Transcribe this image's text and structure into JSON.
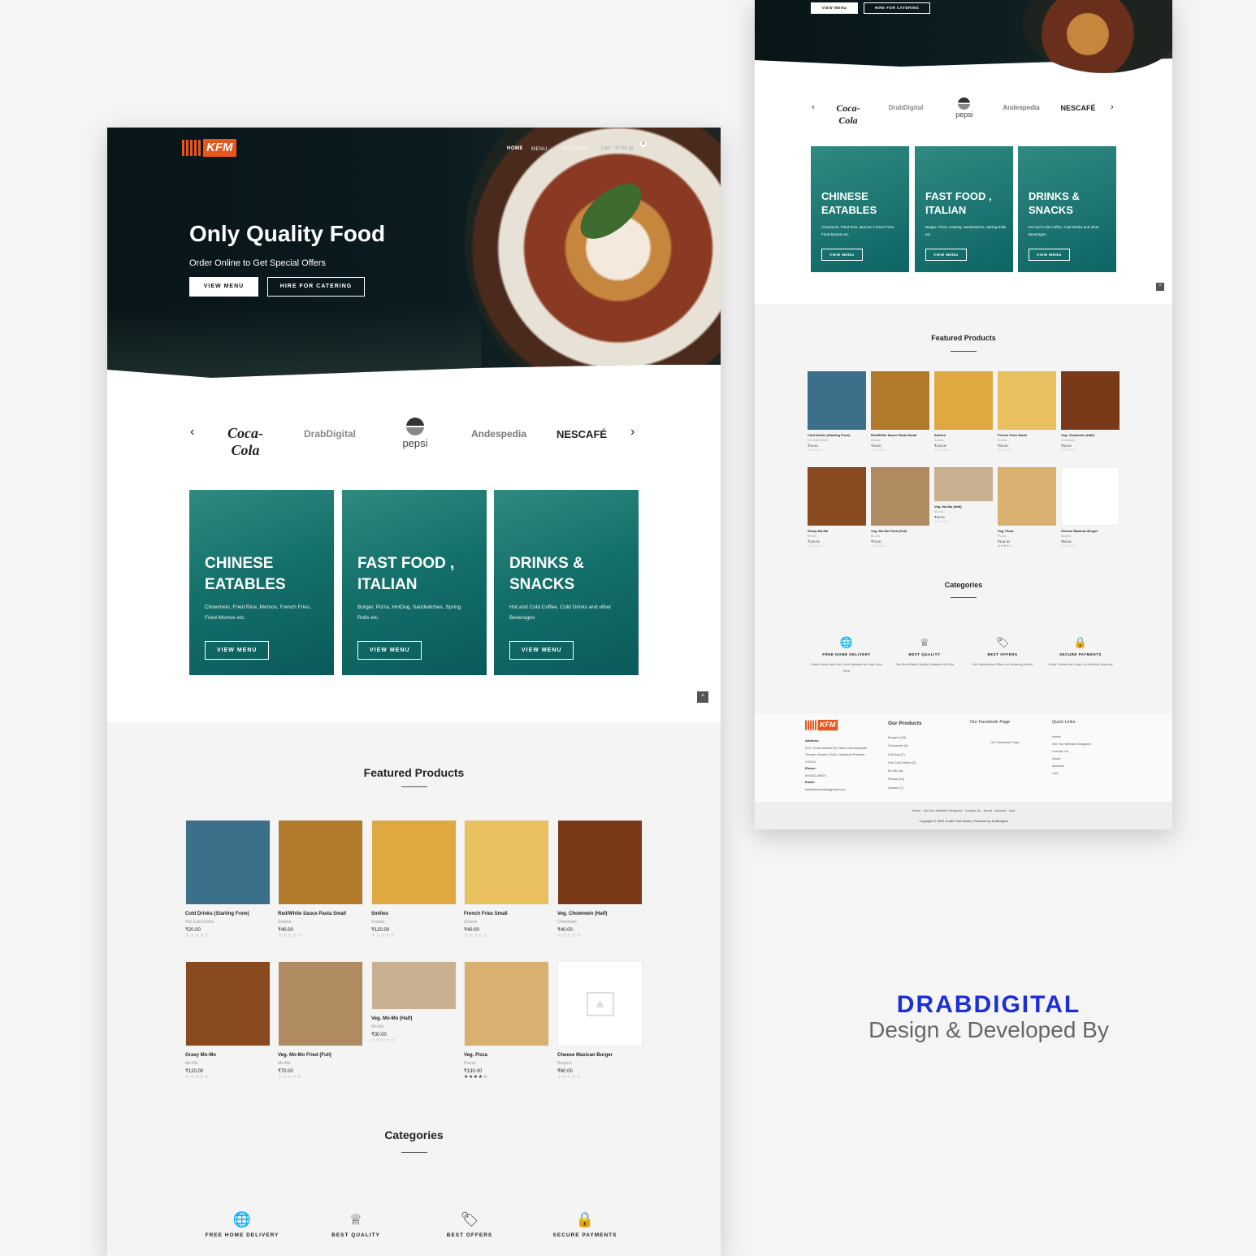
{
  "main": {
    "nav": {
      "logo_text": "KFM",
      "home": "HOME",
      "menu": "MENU",
      "account": "ACCOUNT",
      "cart": "Cart / ₹0.00",
      "cart_count": "0"
    },
    "hero": {
      "title": "Only Quality Food",
      "subtitle": "Order Online to Get Special Offers",
      "view_menu": "VIEW MENU",
      "hire": "HIRE FOR CATERING"
    },
    "brands": [
      "Coca-Cola",
      "DrabDigital",
      "pepsi",
      "Andespedia",
      "NESCAFÉ"
    ],
    "categories": [
      {
        "title": "CHINESE EATABLES",
        "desc": "Chowmein, Fried Rice, Momos, French Fries, Fried Momos etc.",
        "button": "VIEW MENU"
      },
      {
        "title": "FAST FOOD , ITALIAN",
        "desc": "Burger, Pizza, HotDog, Sandwitches, Spring Rolls etc.",
        "button": "VIEW MENU"
      },
      {
        "title": "DRINKS & SNACKS",
        "desc": "Hot and Cold Coffee, Cold Drinks and other Beverages",
        "button": "VIEW MENU"
      }
    ],
    "featured_title": "Featured Products",
    "products": [
      {
        "name": "Cold Drinks (Starting From)",
        "cat": "Hot-Cold Drinks",
        "price": "₹20.00",
        "stars": "☆☆☆☆☆",
        "color": "#3b6f8a"
      },
      {
        "name": "Red/White Sauce Pasta Small",
        "cat": "Snacks",
        "price": "₹40.00",
        "stars": "☆☆☆☆☆",
        "color": "#b07a2a"
      },
      {
        "name": "Smilies",
        "cat": "Snacks",
        "price": "₹120.00",
        "stars": "☆☆☆☆☆",
        "color": "#e0a840"
      },
      {
        "name": "French Fries Small",
        "cat": "Snacks",
        "price": "₹40.00",
        "stars": "☆☆☆☆☆",
        "color": "#e8c060"
      },
      {
        "name": "Veg. Chowmein (Half)",
        "cat": "Chowmain",
        "price": "₹40.00",
        "stars": "☆☆☆☆☆",
        "color": "#7a3a1a"
      },
      {
        "name": "Gravy Mo-Mo",
        "cat": "Mo-Mo",
        "price": "₹120.00",
        "stars": "☆☆☆☆☆",
        "color": "#8a4a20"
      },
      {
        "name": "Veg. Mo-Mo Fried (Full)",
        "cat": "Mo-Mo",
        "price": "₹70.00",
        "stars": "☆☆☆☆☆",
        "color": "#b08a60"
      },
      {
        "name": "Veg. Mo-Mo (Half)",
        "cat": "Mo-Mo",
        "price": "₹30.00",
        "stars": "☆☆☆☆☆",
        "color": "#c8b090"
      },
      {
        "name": "Veg. Pizza",
        "cat": "Pizzas",
        "price": "₹130.00",
        "stars": "★★★★☆",
        "color": "#d8b070"
      },
      {
        "name": "Cheese Maxican Burger",
        "cat": "Burgers",
        "price": "₹60.00",
        "stars": "☆☆☆☆☆",
        "color": "#ffffff"
      }
    ],
    "categories_title": "Categories",
    "features": [
      "FREE HOME DELIVERY",
      "BEST QUALITY",
      "BEST OFFERS",
      "SECURE PAYMENTS"
    ]
  },
  "side": {
    "view_menu": "VIEW MENU",
    "hire": "HIRE FOR CATERING",
    "features": [
      {
        "label": "FREE HOME DELIVERY",
        "desc": "Order Online and Get Your Eatables on Your Door Step"
      },
      {
        "label": "BEST QUALITY",
        "desc": "The Best Rated Quality Eatables of Kullu"
      },
      {
        "label": "BEST OFFERS",
        "desc": "Get Specialized Offers on Ordering Online"
      },
      {
        "label": "SECURE PAYMENTS",
        "desc": "Order Online with Cash on Delivery Securely"
      }
    ],
    "footer": {
      "logo_text": "KFM",
      "address_label": "Address:",
      "address": "97/2, Inner Akhara Rd, Near Laxminarayan Temple, Akhara, Kullu, Himachal Pradesh 175101",
      "phone_label": "Phone:",
      "phone": "094181 05929",
      "email_label": "Email:",
      "email": "kuberfastmeals@gmail.com",
      "products_title": "Our Products",
      "products": [
        "Burgers (18)",
        "Chowmein (6)",
        "Hot Dog (7)",
        "Hot-Cold Drinks (2)",
        "Mo-Mo (6)",
        "Pizzas (16)",
        "Snacks (7)"
      ],
      "fb_title": "Our Facebook Page",
      "fb_link": "Our Facebook Page",
      "links_title": "Quick Links",
      "links": [
        "Home",
        "Get You Website Designed",
        "Contact Us",
        "About",
        "Account",
        "Cart"
      ],
      "bottom_links": "Home   Get You Website Designed   Contact Us   About   Account   Cart",
      "copyright": "Copyright © 2021 Kuber Fast Meals | Powered by DrabDigital"
    }
  },
  "credit": {
    "brand": "DRABDIGITAL",
    "tagline": "Design & Developed By"
  },
  "colors": {
    "accent": "#e8571a",
    "teal": "#14706a",
    "brand_blue": "#1a2fd8",
    "hero_dark": "#0b1b20"
  }
}
